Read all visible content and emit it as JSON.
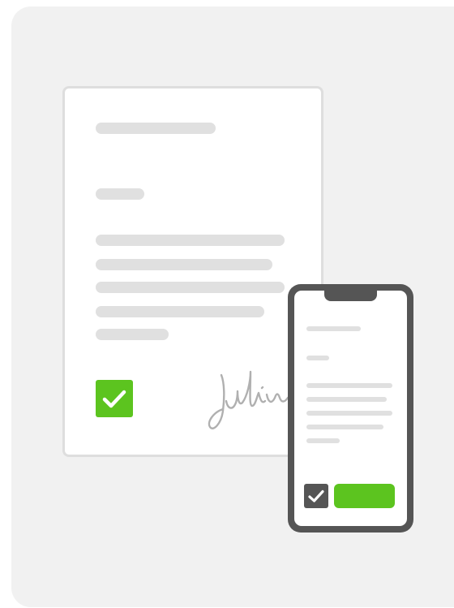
{
  "colors": {
    "panel_background": "#f1f1f1",
    "document_border": "#dedede",
    "placeholder_bar": "#e0e0e0",
    "accent_green": "#5cc41f",
    "phone_body": "#555555",
    "signature_ink": "#b0b0b0"
  },
  "icons": {
    "document_checkbox": "checkmark-icon",
    "phone_checkbox": "checkmark-icon",
    "signature": "handwritten-signature"
  },
  "document": {
    "checkbox_checked": true
  },
  "phone": {
    "checkbox_checked": true,
    "primary_button_label": ""
  }
}
